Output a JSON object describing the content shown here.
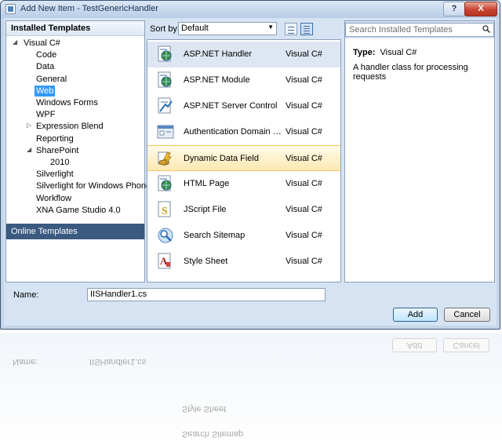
{
  "window": {
    "title": "Add New Item - TestGenericHandler",
    "help_label": "?",
    "close_label": "X"
  },
  "left": {
    "header": "Installed Templates",
    "tree": [
      {
        "label": "Visual C#",
        "level": 0,
        "expander": "open"
      },
      {
        "label": "Code",
        "level": 1
      },
      {
        "label": "Data",
        "level": 1
      },
      {
        "label": "General",
        "level": 1
      },
      {
        "label": "Web",
        "level": 1,
        "selected": true
      },
      {
        "label": "Windows Forms",
        "level": 1
      },
      {
        "label": "WPF",
        "level": 1
      },
      {
        "label": "Expression Blend",
        "level": 1,
        "expander": "closed"
      },
      {
        "label": "Reporting",
        "level": 1
      },
      {
        "label": "SharePoint",
        "level": 1,
        "expander": "open"
      },
      {
        "label": "2010",
        "level": 2
      },
      {
        "label": "Silverlight",
        "level": 1
      },
      {
        "label": "Silverlight for Windows Phone",
        "level": 1
      },
      {
        "label": "Workflow",
        "level": 1
      },
      {
        "label": "XNA Game Studio 4.0",
        "level": 1
      }
    ],
    "online": "Online Templates"
  },
  "sort": {
    "label": "Sort by:",
    "value": "Default"
  },
  "templates": [
    {
      "name": "ASP.NET Handler",
      "lang": "Visual C#",
      "icon": "aspnet-handler-icon",
      "state": "selected"
    },
    {
      "name": "ASP.NET Module",
      "lang": "Visual C#",
      "icon": "aspnet-module-icon"
    },
    {
      "name": "ASP.NET Server Control",
      "lang": "Visual C#",
      "icon": "server-control-icon"
    },
    {
      "name": "Authentication Domain Servi...",
      "lang": "Visual C#",
      "icon": "domain-service-icon"
    },
    {
      "name": "Dynamic Data Field",
      "lang": "Visual C#",
      "icon": "dynamic-data-icon",
      "state": "hover"
    },
    {
      "name": "HTML Page",
      "lang": "Visual C#",
      "icon": "html-page-icon"
    },
    {
      "name": "JScript File",
      "lang": "Visual C#",
      "icon": "jscript-file-icon"
    },
    {
      "name": "Search Sitemap",
      "lang": "Visual C#",
      "icon": "sitemap-icon"
    },
    {
      "name": "Style Sheet",
      "lang": "Visual C#",
      "icon": "style-sheet-icon"
    }
  ],
  "search": {
    "placeholder": "Search Installed Templates"
  },
  "details": {
    "type_label": "Type:",
    "type_value": "Visual C#",
    "description": "A handler class for processing requests"
  },
  "name": {
    "label": "Name:",
    "value": "IISHandler1.cs"
  },
  "buttons": {
    "add": "Add",
    "cancel": "Cancel"
  },
  "reflection": {
    "name_label": "Name:",
    "name_value": "IISHandler1.cs",
    "add": "Add",
    "cancel": "Cancel",
    "item1": "Style Sheet",
    "item2": "Search Sitemap"
  }
}
